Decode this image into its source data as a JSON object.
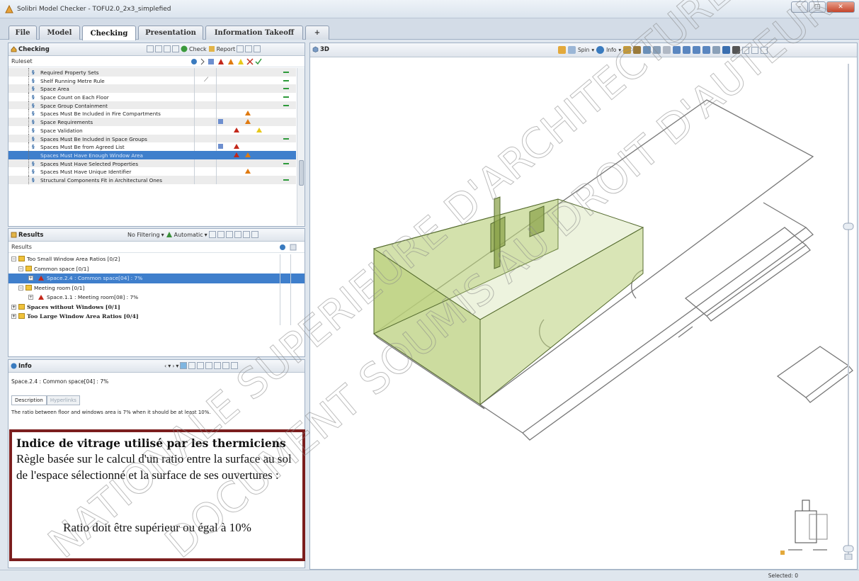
{
  "window": {
    "title": "Solibri Model Checker - TOFU2.0_2x3_simplefied",
    "minimize": "–",
    "maximize": "□",
    "close": "✕"
  },
  "tabs": [
    {
      "label": "File"
    },
    {
      "label": "Model"
    },
    {
      "label": "Checking"
    },
    {
      "label": "Presentation"
    },
    {
      "label": "Information Takeoff"
    },
    {
      "label": "+"
    }
  ],
  "checking": {
    "title": "Checking",
    "check_label": "Check",
    "report_label": "Report",
    "ruleset_header": "Ruleset",
    "rows": [
      {
        "label": "Required Property Sets",
        "prefix": "§"
      },
      {
        "label": "Shelf Running Metre Rule",
        "prefix": "§"
      },
      {
        "label": "Space Area",
        "prefix": "§"
      },
      {
        "label": "Space Count on Each Floor",
        "prefix": "§"
      },
      {
        "label": "Space Group Containment",
        "prefix": "§"
      },
      {
        "label": "Spaces Must Be Included in Fire Compartments",
        "prefix": "§"
      },
      {
        "label": "Space Requirements",
        "prefix": "§"
      },
      {
        "label": "Space Validation",
        "prefix": "§"
      },
      {
        "label": "Spaces Must Be Included in Space Groups",
        "prefix": "§"
      },
      {
        "label": "Spaces Must Be from Agreed List",
        "prefix": "§"
      },
      {
        "label": "Spaces Must Have Enough Window Area",
        "prefix": ""
      },
      {
        "label": "Spaces Must Have Selected Properties",
        "prefix": "§"
      },
      {
        "label": "Spaces Must Have Unique Identifier",
        "prefix": "§"
      },
      {
        "label": "Structural Components Fit in Architectural Ones",
        "prefix": "§"
      }
    ]
  },
  "results": {
    "title": "Results",
    "filter_label": "No Filtering",
    "auto_label": "Automatic",
    "header": "Results",
    "rows": [
      {
        "label": "Too Small Window Area Ratios [0/2]"
      },
      {
        "label": "Common space [0/1]"
      },
      {
        "label": "Space.2.4 : Common space[04] : 7%"
      },
      {
        "label": "Meeting room [0/1]"
      },
      {
        "label": "Space.1.1 : Meeting room[08] : 7%"
      },
      {
        "label": "Spaces without Windows [0/1]"
      },
      {
        "label": "Too Large Window Area Ratios [0/4]"
      }
    ]
  },
  "info": {
    "title": "Info",
    "selected": "Space.2.4 : Common space[04] : 7%",
    "tab_description": "Description",
    "tab_hyperlinks": "Hyperlinks",
    "text": "The ratio between floor and windows area is 7% when it should be at least 10%."
  },
  "annotation": {
    "title": "Indice de vitrage utilisé par les thermiciens",
    "body": "Règle basée sur le calcul d'un ratio entre la surface au sol de l'espace sélectionné et la surface de ses ouvertures :",
    "ratio": "Ratio doit être supérieur ou égal à 10%"
  },
  "view3d": {
    "title": "3D",
    "spin_label": "Spin",
    "info_label": "Info"
  },
  "status": {
    "selected": "Selected: 0"
  },
  "watermark": {
    "line1": "NATIONALE SUPERIEURE D'ARCHITECTURE",
    "line2": "DOCUMENT SOUMIS AU DROIT D'AUTEUR"
  },
  "colors": {
    "accent": "#3f7fcc",
    "annotation_border": "#7b1e1e",
    "space_fill": "#b9cf7a"
  }
}
